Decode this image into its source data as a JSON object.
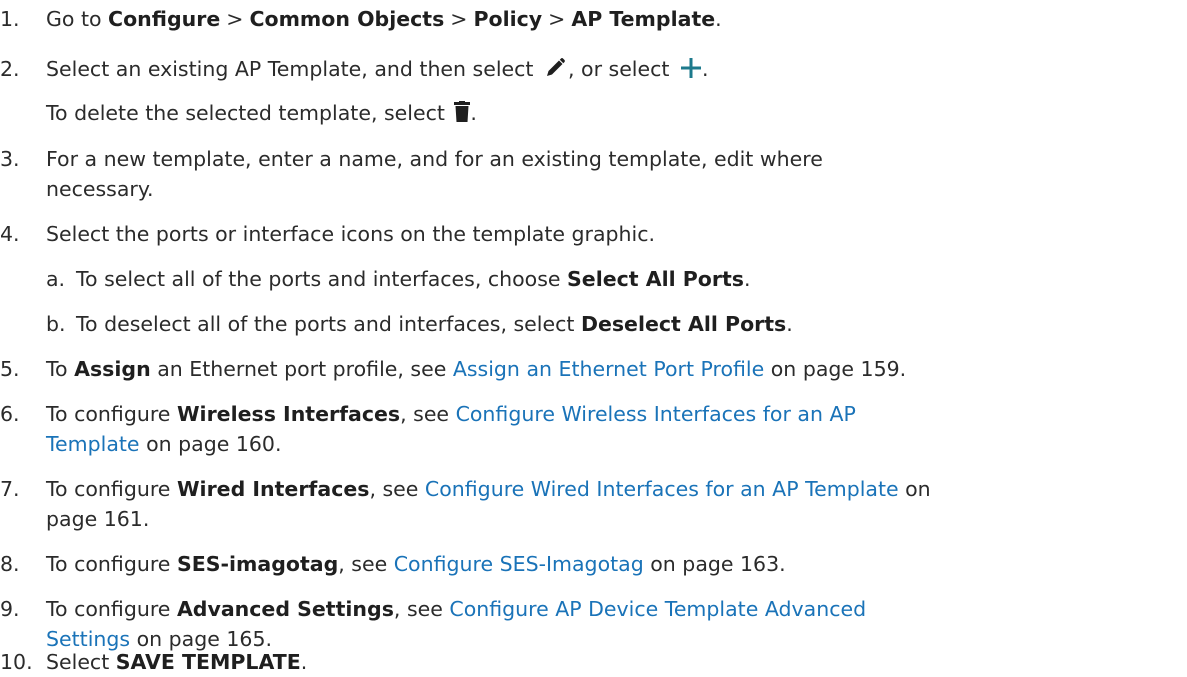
{
  "steps": {
    "s1": {
      "num": "1.",
      "pre": "Go to ",
      "nav1": "Configure",
      "nav2": "Common Objects",
      "nav3": "Policy",
      "nav4": "AP Template",
      "sep": ">",
      "post": "."
    },
    "s2": {
      "num": "2.",
      "pre": "Select an existing AP Template, and then select",
      "mid": ", or select",
      "post": ".",
      "sub_pre": "To delete the selected template, select",
      "sub_post": "."
    },
    "s3": {
      "num": "3.",
      "line1": "For a new template, enter a name, and for an existing template, edit where",
      "line2": "necessary."
    },
    "s4": {
      "num": "4.",
      "text": "Select the ports or interface icons on the template graphic.",
      "a_label": "a.",
      "a_pre": "To select all of the ports and interfaces, choose ",
      "a_bold": "Select All Ports",
      "a_post": ".",
      "b_label": "b.",
      "b_pre": "To deselect all of the ports and interfaces, select ",
      "b_bold": "Deselect All Ports",
      "b_post": "."
    },
    "s5": {
      "num": "5.",
      "pre": "To ",
      "bold": "Assign",
      "mid": " an Ethernet port profile, see ",
      "link": "Assign an Ethernet Port Profile",
      "post": " on page 159."
    },
    "s6": {
      "num": "6.",
      "pre": "To configure ",
      "bold": "Wireless Interfaces",
      "mid": ", see ",
      "link1": "Configure Wireless Interfaces for an AP",
      "link2": "Template",
      "post": " on page 160."
    },
    "s7": {
      "num": "7.",
      "pre": "To configure ",
      "bold": "Wired Interfaces",
      "mid": ", see ",
      "link": "Configure Wired Interfaces for an AP Template",
      "post1": " on",
      "post2": "page 161."
    },
    "s8": {
      "num": "8.",
      "pre": "To configure ",
      "bold": "SES-imagotag",
      "mid": ", see ",
      "link": "Configure SES-Imagotag",
      "post": " on page 163."
    },
    "s9": {
      "num": "9.",
      "pre": "To configure ",
      "bold": "Advanced Settings",
      "mid": ", see ",
      "link1": "Configure AP Device Template Advanced",
      "link2": "Settings",
      "post": " on page 165."
    },
    "s10": {
      "num": "10.",
      "pre": "Select ",
      "bold": "SAVE TEMPLATE",
      "post": "."
    }
  },
  "icons": {
    "edit": "pencil-icon",
    "add": "plus-icon",
    "delete": "trash-icon"
  },
  "colors": {
    "text": "#2b2b2b",
    "link": "#1a73b8",
    "plus": "#1d7a8c",
    "icon_dark": "#1f1f1f"
  }
}
